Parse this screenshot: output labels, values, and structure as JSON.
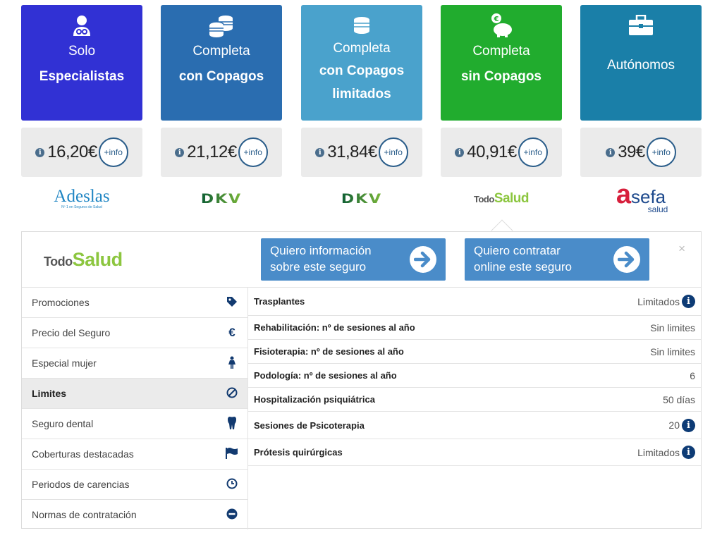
{
  "plans": [
    {
      "line1": "Solo",
      "line2": "Especialistas",
      "color": "#3131d4",
      "icon": "doctor-icon"
    },
    {
      "line1": "Completa",
      "line2": "con Copagos",
      "color": "#2a6db0",
      "icon": "coins-icon"
    },
    {
      "line1": "Completa",
      "line2": "con Copagos limitados",
      "color": "#4aa2cc",
      "icon": "coin-icon"
    },
    {
      "line1": "Completa",
      "line2": "sin Copagos",
      "color": "#21ac2e",
      "icon": "piggy-bank-icon"
    },
    {
      "line1": "Autónomos",
      "line2": "",
      "color": "#1a7fa8",
      "icon": "briefcase-icon"
    }
  ],
  "prices": [
    {
      "value": "16,20€",
      "more": "+info"
    },
    {
      "value": "21,12€",
      "more": "+info"
    },
    {
      "value": "31,84€",
      "more": "+info"
    },
    {
      "value": "40,91€",
      "more": "+info"
    },
    {
      "value": "39€",
      "more": "+info"
    }
  ],
  "insurers": {
    "adeslas": {
      "name": "Adeslas",
      "tagline": "Nº 1 en Seguros de Salud"
    },
    "dkv": "DKV",
    "todosalud": {
      "a": "Todo",
      "b": "Salud"
    },
    "asefa": {
      "a": "a",
      "b": "sefa",
      "sub": "salud"
    }
  },
  "panel": {
    "logo": {
      "a": "Todo",
      "b": "Salud"
    },
    "cta_info": {
      "line1": "Quiero información",
      "line2": "sobre este seguro"
    },
    "cta_buy": {
      "line1": "Quiero contratar",
      "line2": "online este seguro"
    },
    "close": "×",
    "menu": [
      {
        "label": "Promociones",
        "icon": "tag-icon"
      },
      {
        "label": "Precio del Seguro",
        "icon": "euro-icon"
      },
      {
        "label": "Especial mujer",
        "icon": "woman-icon"
      },
      {
        "label": "Limites",
        "icon": "ban-icon"
      },
      {
        "label": "Seguro dental",
        "icon": "tooth-icon"
      },
      {
        "label": "Coberturas destacadas",
        "icon": "flag-icon"
      },
      {
        "label": "Periodos de carencias",
        "icon": "clock-icon"
      },
      {
        "label": "Normas de contratación",
        "icon": "minus-circle-icon"
      }
    ],
    "active_menu": "Limites",
    "rows": [
      {
        "key": "Trasplantes",
        "value": "Limitados",
        "info": true
      },
      {
        "key": "Rehabilitación: nº de sesiones al año",
        "value": "Sin limites",
        "info": false
      },
      {
        "key": "Fisioterapia: nº de sesiones al año",
        "value": "Sin limites",
        "info": false
      },
      {
        "key": "Podología: nº de sesiones al año",
        "value": "6",
        "info": false
      },
      {
        "key": "Hospitalización psiquiátrica",
        "value": "50 días",
        "info": false
      },
      {
        "key": "Sesiones de Psicoterapia",
        "value": "20",
        "info": true
      },
      {
        "key": "Prótesis quirúrgicas",
        "value": "Limitados",
        "info": true
      }
    ]
  }
}
